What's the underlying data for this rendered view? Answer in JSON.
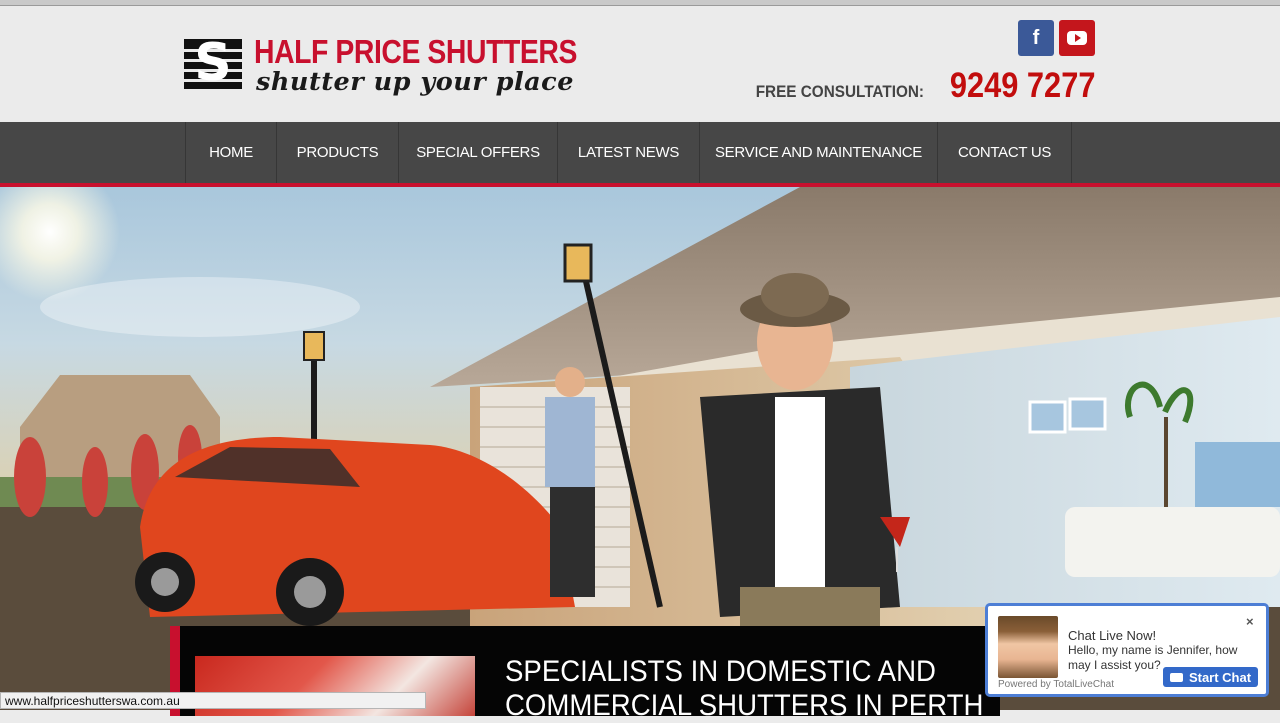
{
  "header": {
    "logo_title": "HALF PRICE SHUTTERS",
    "logo_tagline": "shutter up your place",
    "logo_letter": "S",
    "consult_label": "FREE CONSULTATION:",
    "consult_phone": "9249 7277"
  },
  "social": {
    "facebook_glyph": "f",
    "facebook_icon": "facebook-icon",
    "youtube_icon": "youtube-icon"
  },
  "nav": {
    "items": [
      {
        "label": "HOME"
      },
      {
        "label": "PRODUCTS"
      },
      {
        "label": "SPECIAL OFFERS"
      },
      {
        "label": "LATEST NEWS"
      },
      {
        "label": "SERVICE AND MAINTENANCE"
      },
      {
        "label": "CONTACT US"
      }
    ]
  },
  "hero": {
    "panel_title_line1": "SPECIALISTS IN DOMESTIC AND",
    "panel_title_line2": "COMMERCIAL SHUTTERS IN PERTH"
  },
  "status_bar": {
    "url": "www.halfpriceshutterswa.com.au"
  },
  "chat": {
    "title": "Chat Live Now!",
    "message": "Hello, my name is Jennifer, how may I assist you?",
    "close_glyph": "×",
    "button_label": "Start Chat",
    "powered_by": "Powered by TotalLiveChat"
  },
  "colors": {
    "brand_red": "#c8102e",
    "nav_bg": "#474747",
    "facebook_blue": "#3b5998",
    "youtube_red": "#c4161c",
    "chat_blue": "#3369c9"
  }
}
